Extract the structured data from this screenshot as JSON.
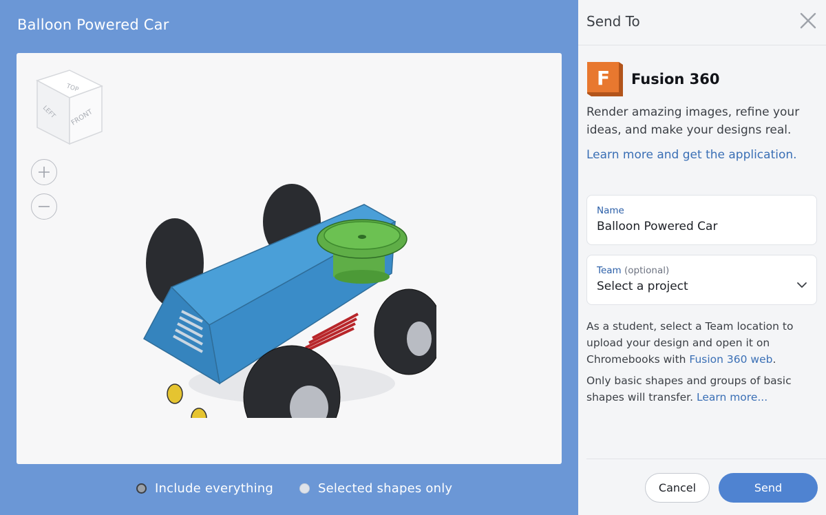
{
  "preview": {
    "title": "Balloon Powered Car",
    "viewcube": {
      "top": "TOP",
      "left": "LEFT",
      "front": "FRONT"
    },
    "zoom_in_icon": "plus-icon",
    "zoom_out_icon": "minus-icon",
    "options": [
      {
        "label": "Include everything",
        "selected": true
      },
      {
        "label": "Selected shapes only",
        "selected": false
      }
    ]
  },
  "panel": {
    "title": "Send To",
    "close_icon": "close-icon",
    "product_logo_letter": "F",
    "product_name": "Fusion 360",
    "description": "Render amazing images, refine your ideas, and make your designs real.",
    "learn_link": "Learn more and get the application.",
    "name_field": {
      "label": "Name",
      "value": "Balloon Powered Car"
    },
    "team_field": {
      "label": "Team",
      "optional": "(optional)",
      "value": "Select a project"
    },
    "note1_text": "As a student, select a Team location to upload your design and open it on Chromebooks with",
    "note1_link": "Fusion 360 web",
    "note1_end": ".",
    "note2_text": "Only basic shapes and groups of basic shapes will transfer.",
    "note2_link": "Learn more...",
    "cancel_label": "Cancel",
    "send_label": "Send"
  },
  "colors": {
    "background": "#6b97d6",
    "accent": "#4f83d1",
    "link": "#3a6fb5",
    "fusion_orange": "#e8782f",
    "car_body": "#3f93cf",
    "car_accent_green": "#5fae47"
  }
}
